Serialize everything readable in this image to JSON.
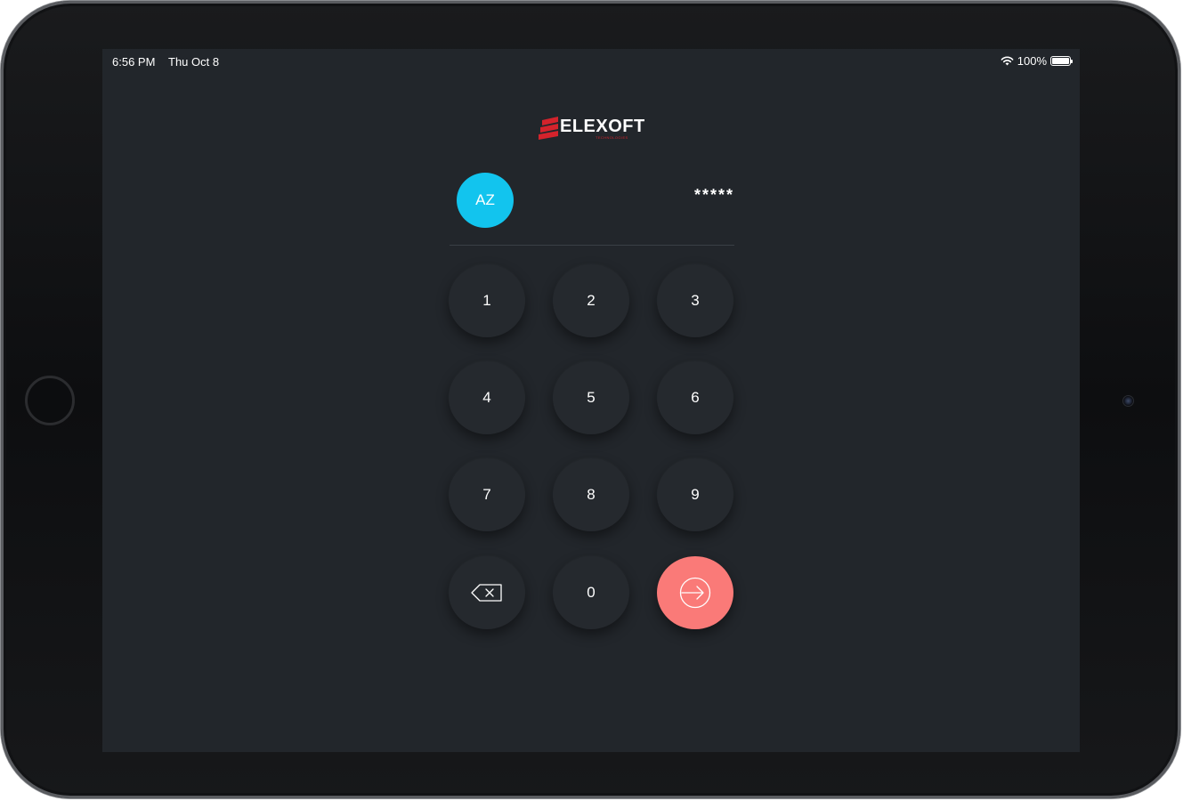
{
  "status_bar": {
    "time": "6:56 PM",
    "date": "Thu Oct 8",
    "battery_label": "100%",
    "battery_level": 1.0,
    "wifi_icon": "wifi-icon",
    "battery_icon": "battery-icon"
  },
  "logo": {
    "name": "ELEXOFT",
    "tagline": "TECHNOLOGIES",
    "brand_color": "#d4232c"
  },
  "user": {
    "initials": "AZ",
    "avatar_color": "#12c4ee"
  },
  "pin": {
    "masked_value": "*****"
  },
  "keypad": {
    "keys": [
      "1",
      "2",
      "3",
      "4",
      "5",
      "6",
      "7",
      "8",
      "9",
      "0"
    ],
    "backspace_icon": "backspace-icon",
    "submit_icon": "login-arrow-icon",
    "submit_color": "#fa7a78"
  },
  "colors": {
    "screen_background": "#22262b",
    "key_background": "#25292e"
  }
}
